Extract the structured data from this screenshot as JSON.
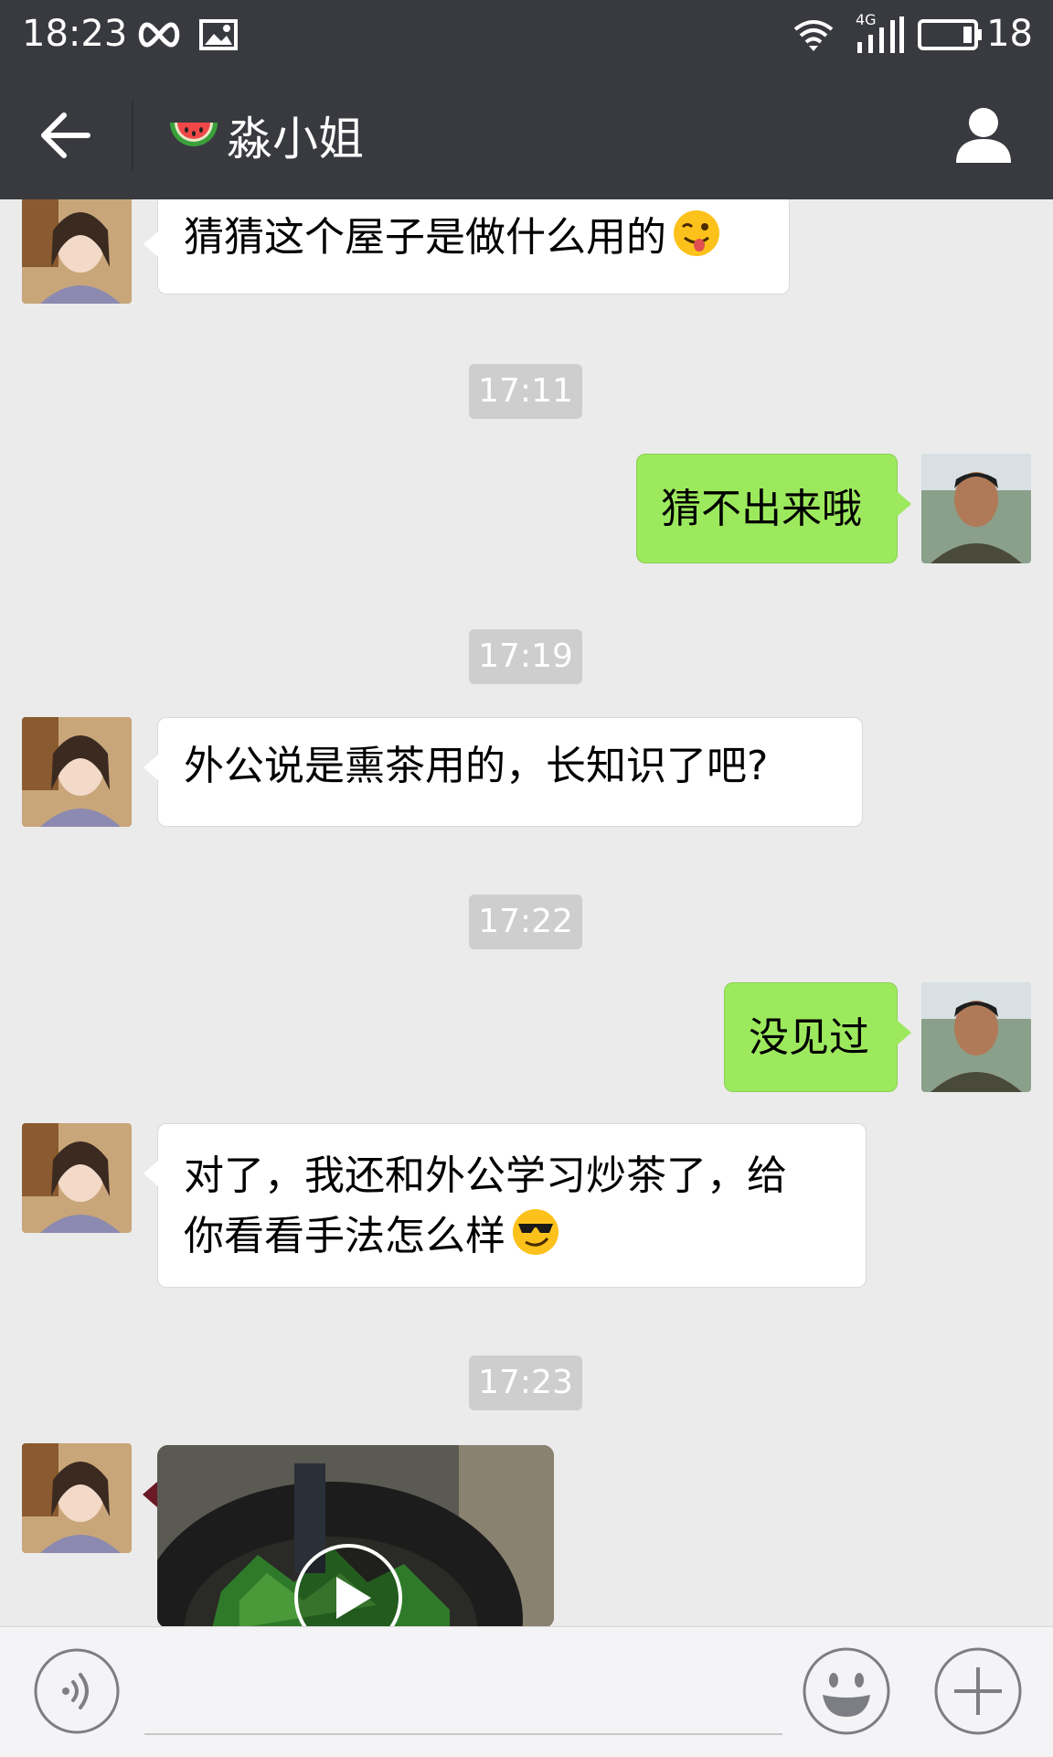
{
  "status_bar": {
    "time": "18:23",
    "network": "4G",
    "battery": "18",
    "icons": [
      "infinity-icon",
      "image-icon",
      "wifi-icon",
      "signal-icon",
      "battery-icon"
    ]
  },
  "header": {
    "title_emoji": "watermelon-icon",
    "title": "淼小姐",
    "back_icon": "arrow-left-icon",
    "profile_icon": "person-icon"
  },
  "messages": [
    {
      "type": "incoming",
      "text": "猜猜这个屋子是做什么用的",
      "emoji": "winking-tongue-emoji"
    },
    {
      "type": "timestamp",
      "text": "17:11"
    },
    {
      "type": "outgoing",
      "text": "猜不出来哦"
    },
    {
      "type": "timestamp",
      "text": "17:19"
    },
    {
      "type": "incoming",
      "text": "外公说是熏茶用的，长知识了吧?"
    },
    {
      "type": "timestamp",
      "text": "17:22"
    },
    {
      "type": "outgoing",
      "text": "没见过"
    },
    {
      "type": "incoming",
      "line1": "对了，我还和外公学习炒茶了，给",
      "line2": "你看看手法怎么样",
      "emoji": "sunglasses-emoji"
    },
    {
      "type": "timestamp",
      "text": "17:23"
    },
    {
      "type": "incoming-video",
      "icon": "play-icon"
    }
  ],
  "input_bar": {
    "voice_icon": "voice-icon",
    "message_value": "",
    "emoji_icon": "smiley-icon",
    "more_icon": "plus-icon"
  },
  "colors": {
    "bar": "#393a3f",
    "background": "#ebebeb",
    "outgoing_bubble": "#9de95e",
    "incoming_bubble": "#ffffff",
    "timestamp_bg": "#cecece"
  }
}
